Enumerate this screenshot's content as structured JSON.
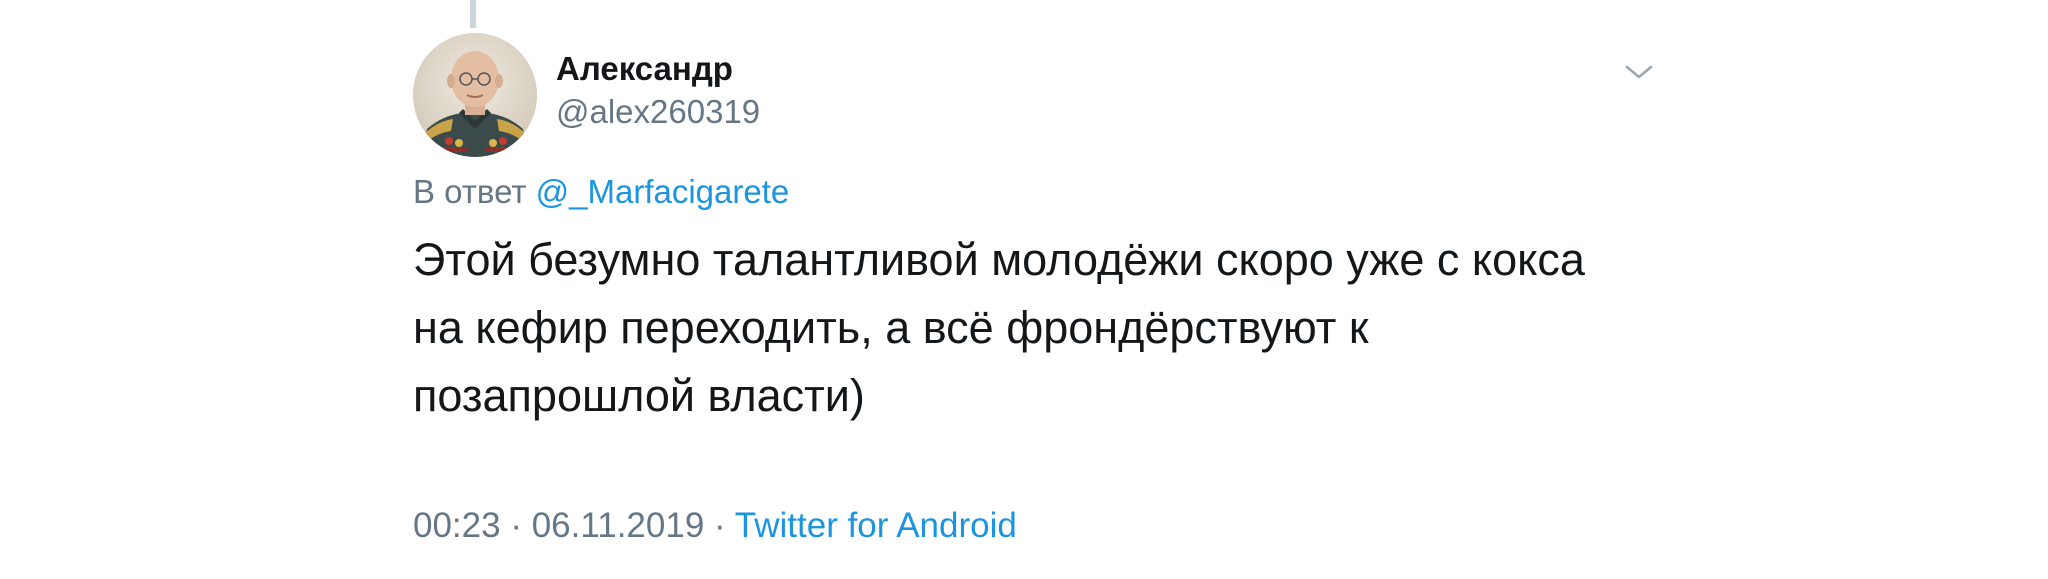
{
  "tweet": {
    "author": {
      "name": "Александр",
      "handle": "@alex260319"
    },
    "reply": {
      "prefix": "В ответ",
      "mention": "@_Marfacigarete"
    },
    "text_lines": [
      "Этой безумно талантливой молодёжи скоро уже с кокса",
      "на кефир переходить, а всё фрондёрствуют к",
      "позапрошлой власти)"
    ],
    "time": "00:23",
    "date": "06.11.2019",
    "separator": "·",
    "source": "Twitter for Android",
    "icons": {
      "menu": "chevron-down-icon"
    }
  },
  "colors": {
    "text": "#14171a",
    "secondary": "#657786",
    "link": "#1b95e0",
    "thread_line": "#ccd6dd"
  }
}
